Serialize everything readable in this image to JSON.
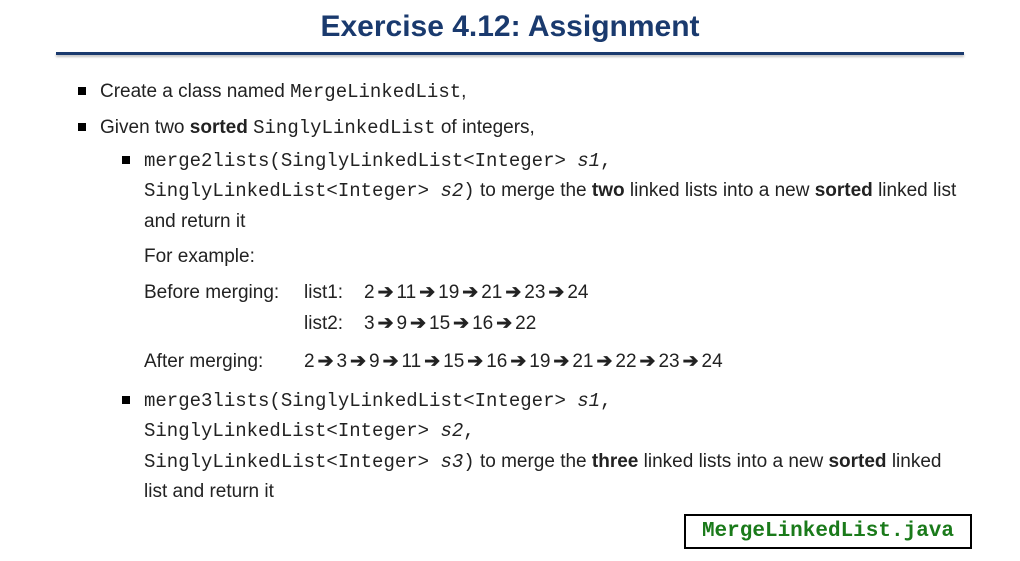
{
  "title": "Exercise 4.12: Assignment",
  "bullets": {
    "b1_pre": "Create a class named ",
    "b1_code": "MergeLinkedList",
    "b1_post": ",",
    "b2_pre": "Given two ",
    "b2_bold": "sorted",
    "b2_post1": " ",
    "b2_code": "SinglyLinkedList",
    "b2_post2": " of integers,"
  },
  "m2": {
    "sig_line1a": "merge2lists(SinglyLinkedList<Integer> ",
    "sig_line1b": "s1",
    "sig_line1c": ",",
    "sig_line2a": "SinglyLinkedList<Integer> ",
    "sig_line2b": "s2",
    "sig_line2c": ")",
    "desc_pre": " to merge the ",
    "desc_bold1": "two",
    "desc_mid": " linked lists into a new ",
    "desc_bold2": "sorted",
    "desc_post": " linked list and return it"
  },
  "example": {
    "for_example": "For example:",
    "before_label": "Before merging:",
    "after_label": "After merging:",
    "list1_label": "list1:",
    "list2_label": "list2:",
    "list1": [
      "2",
      "11",
      "19",
      "21",
      "23",
      "24"
    ],
    "list2": [
      "3",
      "9",
      "15",
      "16",
      "22"
    ],
    "merged": [
      "2",
      "3",
      "9",
      "11",
      "15",
      "16",
      "19",
      "21",
      "22",
      "23",
      "24"
    ]
  },
  "m3": {
    "sig_line1a": "merge3lists(SinglyLinkedList<Integer> ",
    "sig_line1b": "s1",
    "sig_line1c": ",",
    "sig_line2a": "SinglyLinkedList<Integer> ",
    "sig_line2b": "s2",
    "sig_line2c": ",",
    "sig_line3a": "SinglyLinkedList<Integer> ",
    "sig_line3b": "s3",
    "sig_line3c": ")",
    "desc_pre": " to merge the ",
    "desc_bold1": "three",
    "desc_mid": " linked lists into a new ",
    "desc_bold2": "sorted",
    "desc_post": " linked list and return it"
  },
  "filename": "MergeLinkedList.java"
}
